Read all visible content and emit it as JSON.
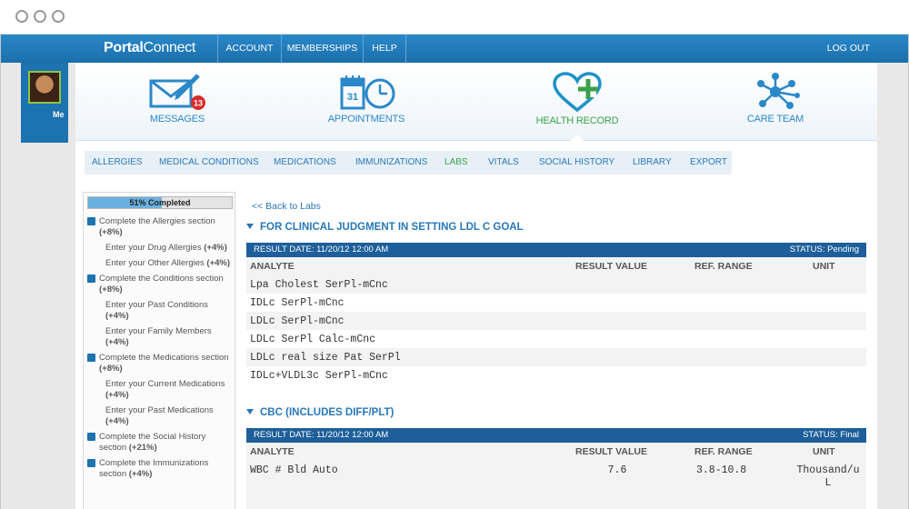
{
  "browser": {
    "dots": 3
  },
  "topnav": {
    "brand_bold": "Portal",
    "brand_light": "Connect",
    "items": [
      "ACCOUNT",
      "MEMBERSHIPS",
      "HELP"
    ],
    "logout": "LOG OUT"
  },
  "user": {
    "label": "Me"
  },
  "apps": [
    {
      "label": "MESSAGES",
      "icon": "envelope-pen-icon",
      "badge": "13"
    },
    {
      "label": "APPOINTMENTS",
      "icon": "calendar-clock-icon",
      "calendar_day": "31"
    },
    {
      "label": "HEALTH RECORD",
      "icon": "heart-plus-icon",
      "active": true
    },
    {
      "label": "CARE TEAM",
      "icon": "network-nodes-icon"
    }
  ],
  "subnav": {
    "items": [
      "ALLERGIES",
      "MEDICAL CONDITIONS",
      "MEDICATIONS",
      "IMMUNIZATIONS",
      "LABS",
      "VITALS",
      "SOCIAL HISTORY",
      "LIBRARY",
      "EXPORT"
    ],
    "active": "LABS"
  },
  "progress": {
    "percent": 51,
    "label": "51% Completed",
    "items": [
      {
        "text": "Complete the Allergies section",
        "pts": "(+8%)",
        "level": 0
      },
      {
        "text": "Enter your Drug Allergies",
        "pts": "(+4%)",
        "level": 1
      },
      {
        "text": "Enter your Other Allergies",
        "pts": "(+4%)",
        "level": 1
      },
      {
        "text": "Complete the Conditions section",
        "pts": "(+8%)",
        "level": 0
      },
      {
        "text": "Enter your Past Conditions",
        "pts": "(+4%)",
        "level": 1
      },
      {
        "text": "Enter your Family Members",
        "pts": "(+4%)",
        "level": 1
      },
      {
        "text": "Complete the Medications section",
        "pts": "(+8%)",
        "level": 0
      },
      {
        "text": "Enter your Current Medications",
        "pts": "(+4%)",
        "level": 1
      },
      {
        "text": "Enter your Past Medications",
        "pts": "(+4%)",
        "level": 1
      },
      {
        "text": "Complete the Social History section",
        "pts": "(+21%)",
        "level": 0
      },
      {
        "text": "Complete the Immunizations section",
        "pts": "(+4%)",
        "level": 0
      }
    ]
  },
  "results": {
    "back_link": "<< Back to Labs",
    "columns": {
      "analyte": "ANALYTE",
      "value": "RESULT VALUE",
      "range": "REF. RANGE",
      "unit": "UNIT"
    },
    "sections": [
      {
        "title": "FOR CLINICAL JUDGMENT IN SETTING LDL C GOAL",
        "result_date": "RESULT DATE:  11/20/12 12:00 AM",
        "status": "STATUS:  Pending",
        "rows": [
          {
            "analyte": "Lpa Cholest SerPl-mCnc",
            "value": "",
            "range": "",
            "unit": ""
          },
          {
            "analyte": "IDLc SerPl-mCnc",
            "value": "",
            "range": "",
            "unit": ""
          },
          {
            "analyte": "LDLc SerPl-mCnc",
            "value": "",
            "range": "",
            "unit": ""
          },
          {
            "analyte": "LDLc SerPl Calc-mCnc",
            "value": "",
            "range": "",
            "unit": ""
          },
          {
            "analyte": "LDLc real size Pat SerPl",
            "value": "",
            "range": "",
            "unit": ""
          },
          {
            "analyte": "IDLc+VLDL3c SerPl-mCnc",
            "value": "",
            "range": "",
            "unit": ""
          }
        ]
      },
      {
        "title": "CBC (INCLUDES DIFF/PLT)",
        "result_date": "RESULT DATE:  11/20/12 12:00 AM",
        "status": "STATUS:  Final",
        "rows": [
          {
            "analyte": "WBC # Bld Auto",
            "value": "7.6",
            "range": "3.8-10.8",
            "unit": "Thousand/u L"
          }
        ]
      }
    ]
  }
}
